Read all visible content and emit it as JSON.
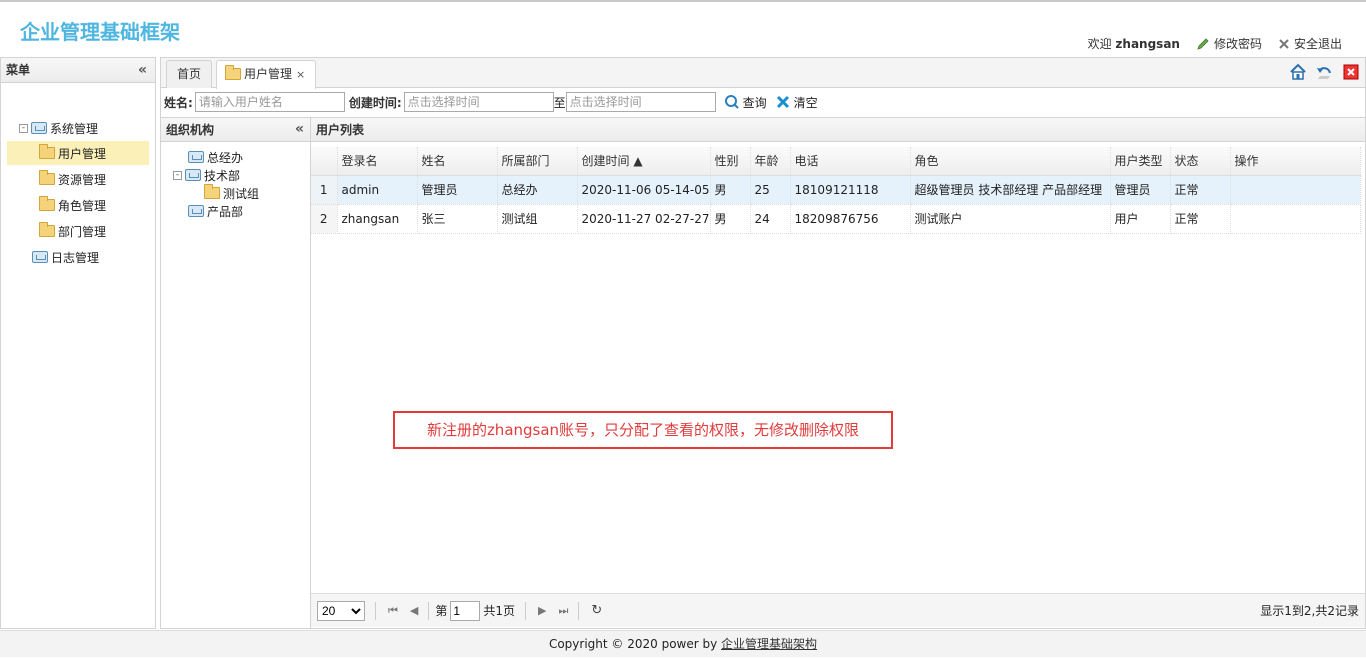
{
  "app": {
    "title": "企业管理基础框架"
  },
  "header": {
    "welcome_prefix": "欢迎",
    "username": "zhangsan",
    "change_password": "修改密码",
    "logout": "安全退出"
  },
  "menu": {
    "title": "菜单",
    "collapse_glyph": "«",
    "items": [
      {
        "label": "系统管理",
        "expander": "-"
      },
      {
        "label": "用户管理"
      },
      {
        "label": "资源管理"
      },
      {
        "label": "角色管理"
      },
      {
        "label": "部门管理"
      },
      {
        "label": "日志管理"
      }
    ]
  },
  "tabs": [
    {
      "label": "首页"
    },
    {
      "label": "用户管理",
      "close": "×"
    }
  ],
  "search": {
    "name_label": "姓名:",
    "name_placeholder": "请输入用户姓名",
    "time_label": "创建时间:",
    "start_placeholder": "点击选择时间",
    "to": "至",
    "end_placeholder": "点击选择时间",
    "query": "查询",
    "clear": "清空"
  },
  "org": {
    "title": "组织机构",
    "collapse_glyph": "«",
    "nodes": [
      {
        "label": "总经办"
      },
      {
        "label": "技术部",
        "expander": "-"
      },
      {
        "label": "测试组"
      },
      {
        "label": "产品部"
      }
    ]
  },
  "users": {
    "title": "用户列表",
    "columns": [
      "登录名",
      "姓名",
      "所属部门",
      "创建时间 ▲",
      "性别",
      "年龄",
      "电话",
      "角色",
      "用户类型",
      "状态",
      "操作"
    ],
    "rows": [
      {
        "n": "1",
        "login": "admin",
        "name": "管理员",
        "dept": "总经办",
        "created": "2020-11-06 05-14-05",
        "gender": "男",
        "age": "25",
        "phone": "18109121118",
        "roles": "超级管理员 技术部经理 产品部经理",
        "type": "管理员",
        "status": "正常",
        "ops": ""
      },
      {
        "n": "2",
        "login": "zhangsan",
        "name": "张三",
        "dept": "测试组",
        "created": "2020-11-27 02-27-27",
        "gender": "男",
        "age": "24",
        "phone": "18209876756",
        "roles": "测试账户",
        "type": "用户",
        "status": "正常",
        "ops": ""
      }
    ]
  },
  "pager": {
    "page_size": "20",
    "page_prefix": "第",
    "page_value": "1",
    "page_total": "共1页",
    "info": "显示1到2,共2记录"
  },
  "annotation": "新注册的zhangsan账号，只分配了查看的权限，无修改删除权限",
  "footer": {
    "text": "Copyright © 2020 power by",
    "link": "企业管理基础架构"
  }
}
